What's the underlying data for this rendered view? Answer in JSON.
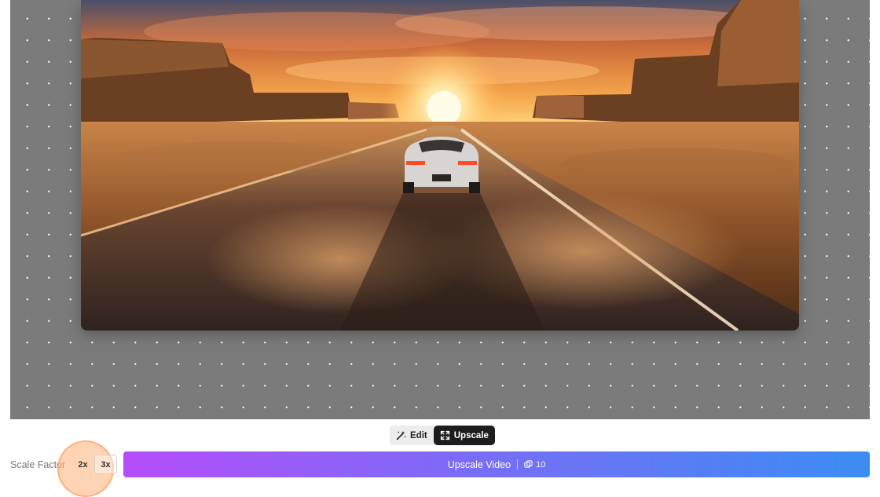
{
  "toolbar": {
    "modes": [
      {
        "label": "Edit",
        "icon": "magic-wand-icon",
        "active": false
      },
      {
        "label": "Upscale",
        "icon": "expand-icon",
        "active": true
      }
    ]
  },
  "scale_factor": {
    "label": "Scale Factor",
    "options": [
      "2x",
      "3x"
    ],
    "selected": "3x"
  },
  "cta": {
    "label": "Upscale Video",
    "credit_icon": "credits-icon",
    "credits": "10"
  },
  "colors": {
    "canvas": "#7b7b7b",
    "active_mode": "#1d1d1d",
    "gradient_start": "#b54dfb",
    "gradient_end": "#3b8cf3",
    "highlight": "#ffb078"
  }
}
